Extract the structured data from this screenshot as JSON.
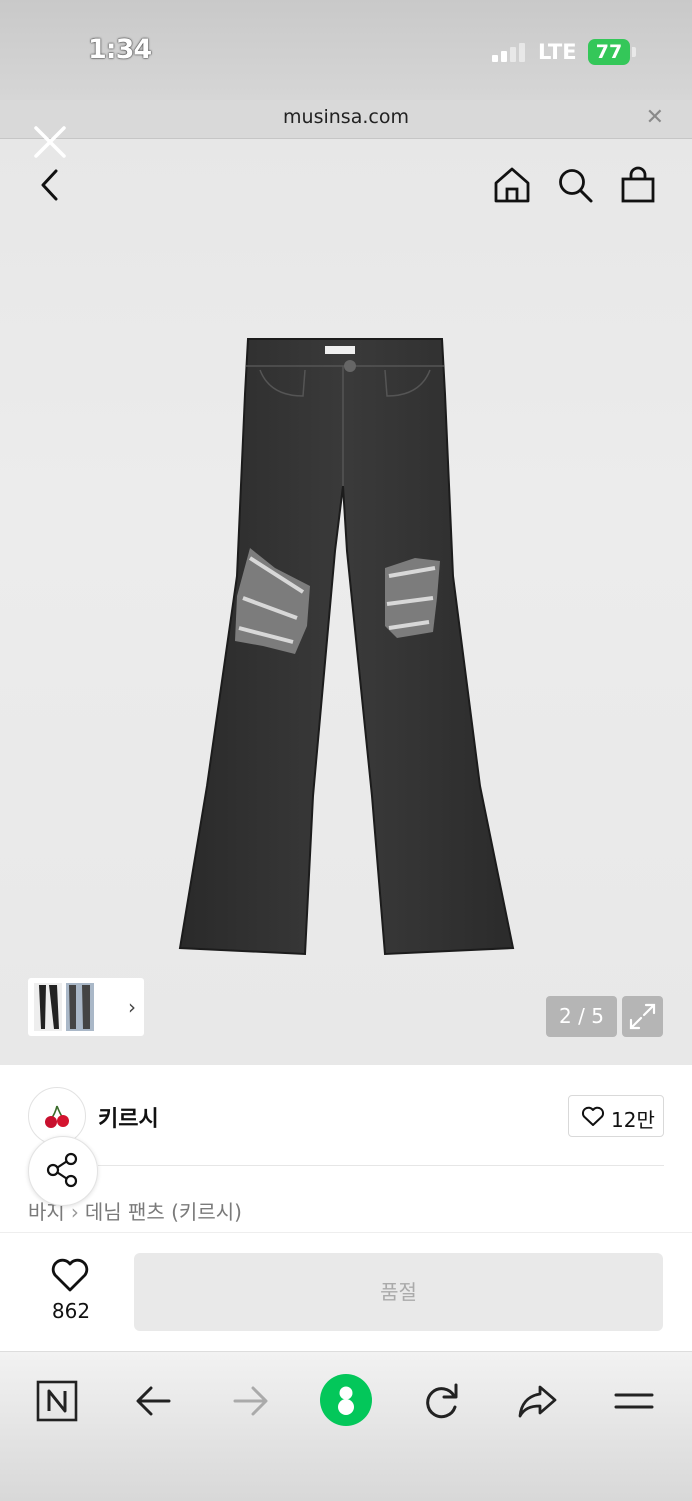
{
  "status_bar": {
    "time": "1:34",
    "network": "LTE",
    "battery": "77"
  },
  "browser": {
    "url": "musinsa.com",
    "close_glyph": "✕"
  },
  "icons": {
    "back": "chevron-left-icon",
    "home": "home-icon",
    "search": "search-icon",
    "bag": "shopping-bag-icon",
    "overlay_close": "close-icon",
    "share": "share-icon",
    "heart": "heart-icon"
  },
  "gallery": {
    "page_indicator": "2 / 5",
    "thumb_chevron": "›"
  },
  "brand": {
    "name": "키르시",
    "likes": "12만"
  },
  "breadcrumb": {
    "category": "바지",
    "separator": "›",
    "subcategory": "데님 팬츠 (키르시)"
  },
  "purchase": {
    "wishlist_count": "862",
    "button_label": "품절"
  },
  "colors": {
    "battery_green": "#34c759",
    "naver_green": "#03c75a",
    "soldout_bg": "#e9e9e9"
  }
}
